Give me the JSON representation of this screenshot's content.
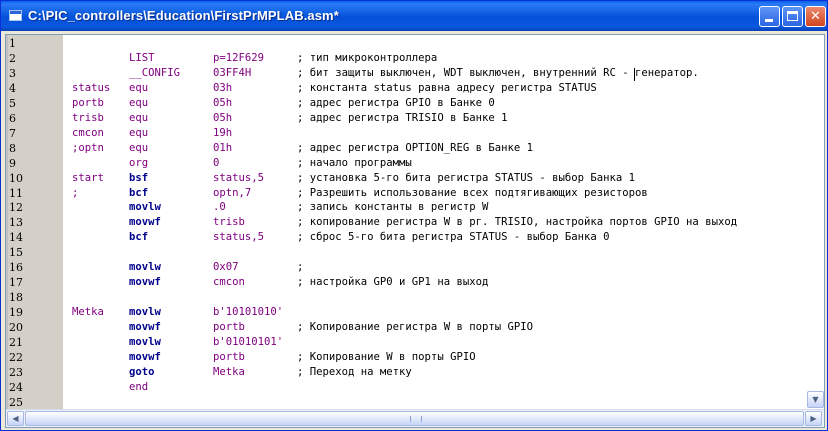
{
  "window": {
    "title": "C:\\PIC_controllers\\Education\\FirstPrMPLAB.asm*",
    "minimize_glyph": "",
    "maximize_glyph": "",
    "close_glyph": "✕"
  },
  "editor": {
    "lines": [
      {
        "n": "1",
        "label": "",
        "op": "",
        "arg": "",
        "comment": ""
      },
      {
        "n": "2",
        "label": "",
        "op": "LIST",
        "arg": "p=12F629",
        "comment": "; тип микроконтроллера"
      },
      {
        "n": "3",
        "label": "",
        "op": "__CONFIG",
        "arg": "03FF4H",
        "comment": "; бит защиты выключен, WDT выключен, внутренний RC - генератор."
      },
      {
        "n": "4",
        "label": "status",
        "op": "equ",
        "arg": "03h",
        "comment": "; константа status равна адресу регистра STATUS"
      },
      {
        "n": "5",
        "label": "portb",
        "op": "equ",
        "arg": "05h",
        "comment": "; адрес регистра GPIO в Банке 0"
      },
      {
        "n": "6",
        "label": "trisb",
        "op": "equ",
        "arg": "05h",
        "comment": "; адрес регистра TRISIO в Банке 1"
      },
      {
        "n": "7",
        "label": "cmcon",
        "op": "equ",
        "arg": "19h",
        "comment": ""
      },
      {
        "n": "8",
        "label": ";optn",
        "op": "equ",
        "arg": "01h",
        "comment": "; адрес регистра OPTION_REG в Банке 1"
      },
      {
        "n": "9",
        "label": "",
        "op": "org",
        "arg": "0",
        "comment": "; начало программы"
      },
      {
        "n": "10",
        "label": "start",
        "op": "bsf",
        "arg": "status,5",
        "comment": "; установка 5-го бита регистра STATUS - выбор Банка 1"
      },
      {
        "n": "11",
        "label": ";",
        "op": "bcf",
        "arg": "optn,7",
        "comment": "; Разрешить использование всех подтягивающих резисторов"
      },
      {
        "n": "12",
        "label": "",
        "op": "movlw",
        "arg": ".0",
        "comment": "; запись константы в регистр W"
      },
      {
        "n": "13",
        "label": "",
        "op": "movwf",
        "arg": "trisb",
        "comment": "; копирование регистра W в рг. TRISIO, настройка портов GPIO на выход"
      },
      {
        "n": "14",
        "label": "",
        "op": "bcf",
        "arg": "status,5",
        "comment": "; сброс 5-го бита регистра STATUS - выбор Банка 0"
      },
      {
        "n": "15",
        "label": "",
        "op": "",
        "arg": "",
        "comment": ""
      },
      {
        "n": "16",
        "label": "",
        "op": "movlw",
        "arg": "0x07",
        "comment": ";"
      },
      {
        "n": "17",
        "label": "",
        "op": "movwf",
        "arg": "cmcon",
        "comment": "; настройка GP0 и GP1 на выход"
      },
      {
        "n": "18",
        "label": "",
        "op": "",
        "arg": "",
        "comment": ""
      },
      {
        "n": "19",
        "label": "Metka",
        "op": "movlw",
        "arg": "b'10101010'",
        "comment": ""
      },
      {
        "n": "20",
        "label": "",
        "op": "movwf",
        "arg": "portb",
        "comment": "; Копирование регистра W в порты GPIO"
      },
      {
        "n": "21",
        "label": "",
        "op": "movlw",
        "arg": "b'01010101'",
        "comment": ""
      },
      {
        "n": "22",
        "label": "",
        "op": "movwf",
        "arg": "portb",
        "comment": "; Копирование W в порты GPIO"
      },
      {
        "n": "23",
        "label": "",
        "op": "goto",
        "arg": "Metka",
        "comment": "; Переход на метку"
      },
      {
        "n": "24",
        "label": "",
        "op": "end",
        "arg": "",
        "comment": ""
      },
      {
        "n": "25",
        "label": "",
        "op": "",
        "arg": "",
        "comment": ""
      }
    ]
  },
  "scrollbar": {
    "left_arrow": "◀",
    "right_arrow": "▶",
    "down_arrow": "▼"
  }
}
